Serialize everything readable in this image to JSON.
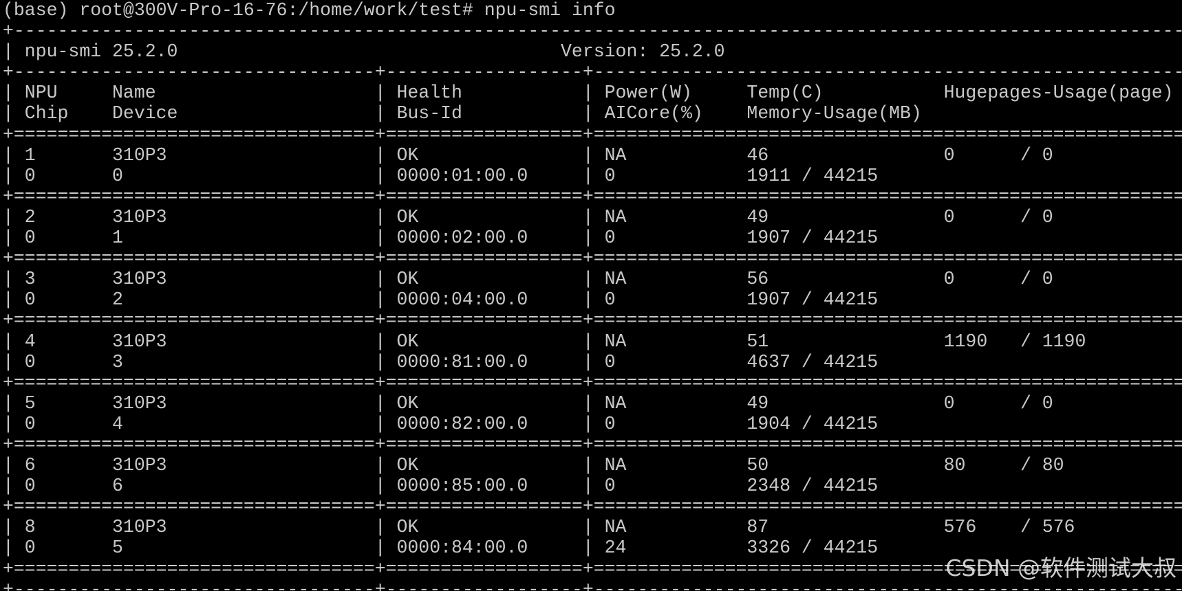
{
  "terminal": {
    "prompt": "(base) root@300V-Pro-16-76:/home/work/test# ",
    "command": "npu-smi info",
    "lines": [
      "+------------------------------------------------------------------------------------------------------------+",
      "| npu-smi 25.2.0                                   Version: 25.2.0                                              |",
      "+---------------------------------+------------------+-----------------------------------------------------------+",
      "| NPU     Name                    | Health           | Power(W)     Temp(C)           Hugepages-Usage(page)    |",
      "| Chip    Device                  | Bus-Id           | AICore(%)    Memory-Usage(MB)                           |",
      "+=================================+==================+===========================================================+",
      "| 1       310P3                   | OK               | NA           46                0      / 0               |",
      "| 0       0                       | 0000:01:00.0     | 0            1911 / 44215                               |",
      "+=================================+==================+===========================================================+",
      "| 2       310P3                   | OK               | NA           49                0      / 0               |",
      "| 0       1                       | 0000:02:00.0     | 0            1907 / 44215                               |",
      "+=================================+==================+===========================================================+",
      "| 3       310P3                   | OK               | NA           56                0      / 0               |",
      "| 0       2                       | 0000:04:00.0     | 0            1907 / 44215                               |",
      "+=================================+==================+===========================================================+",
      "| 4       310P3                   | OK               | NA           51                1190   / 1190            |",
      "| 0       3                       | 0000:81:00.0     | 0            4637 / 44215                               |",
      "+=================================+==================+===========================================================+",
      "| 5       310P3                   | OK               | NA           49                0      / 0               |",
      "| 0       4                       | 0000:82:00.0     | 0            1904 / 44215                               |",
      "+=================================+==================+===========================================================+",
      "| 6       310P3                   | OK               | NA           50                80     / 80              |",
      "| 0       6                       | 0000:85:00.0     | 0            2348 / 44215                               |",
      "+=================================+==================+===========================================================+",
      "| 8       310P3                   | OK               | NA           87                576    / 576             |",
      "| 0       5                       | 0000:84:00.0     | 24           3326 / 44215                               |",
      "+=================================+==================+===========================================================+",
      "+---------------------------------+------------------+-----------------------------------------------------------+"
    ]
  },
  "watermark": "CSDN @软件测试大叔",
  "colors": {
    "background": "#000000",
    "text": "#c8c8c8"
  }
}
